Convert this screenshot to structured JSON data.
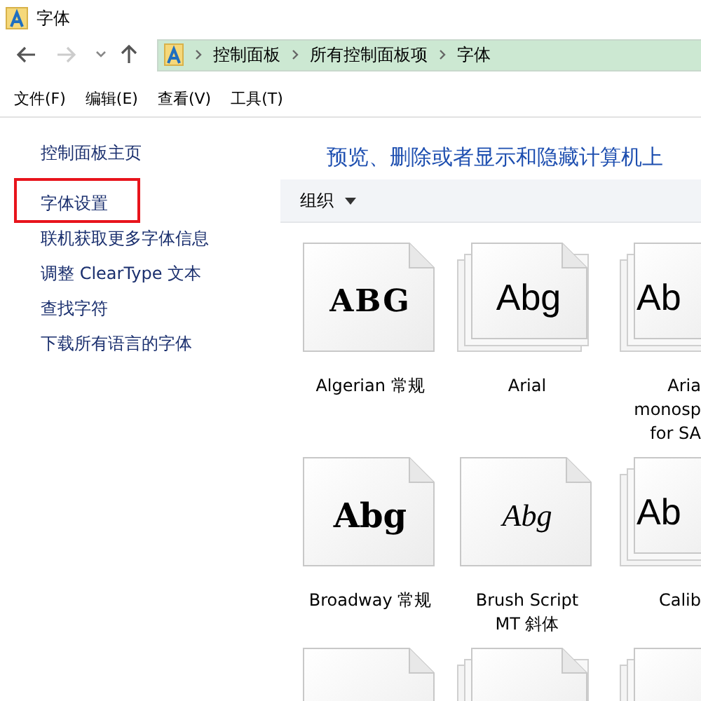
{
  "window": {
    "title": "字体"
  },
  "address_bar": {
    "crumbs": [
      "控制面板",
      "所有控制面板项",
      "字体"
    ]
  },
  "menu": [
    "文件(F)",
    "编辑(E)",
    "查看(V)",
    "工具(T)"
  ],
  "sidebar": {
    "items": [
      {
        "label": "控制面板主页",
        "highlighted": false
      },
      {
        "label": "字体设置",
        "highlighted": true
      },
      {
        "label": "联机获取更多字体信息",
        "highlighted": false
      },
      {
        "label": "调整 ClearType 文本",
        "highlighted": false
      },
      {
        "label": "查找字符",
        "highlighted": false
      },
      {
        "label": "下载所有语言的字体",
        "highlighted": false
      }
    ]
  },
  "heading": "预览、删除或者显示和隐藏计算机上",
  "toolbar": {
    "organize": "组织"
  },
  "fonts": [
    {
      "kind": "single",
      "preview": "ABG",
      "label": "Algerian 常规"
    },
    {
      "kind": "family",
      "preview": "Abg",
      "label": "Arial"
    },
    {
      "kind": "family",
      "preview": "Ab",
      "label": "Aria\nmonosp\nfor SA"
    },
    {
      "kind": "single",
      "preview": "Abg",
      "label": "Broadway 常规"
    },
    {
      "kind": "single",
      "preview": "Abg",
      "label": "Brush Script\nMT 斜体"
    },
    {
      "kind": "family",
      "preview": "Ab",
      "label": "Calib"
    },
    {
      "kind": "single"
    },
    {
      "kind": "family"
    },
    {
      "kind": "family"
    }
  ]
}
